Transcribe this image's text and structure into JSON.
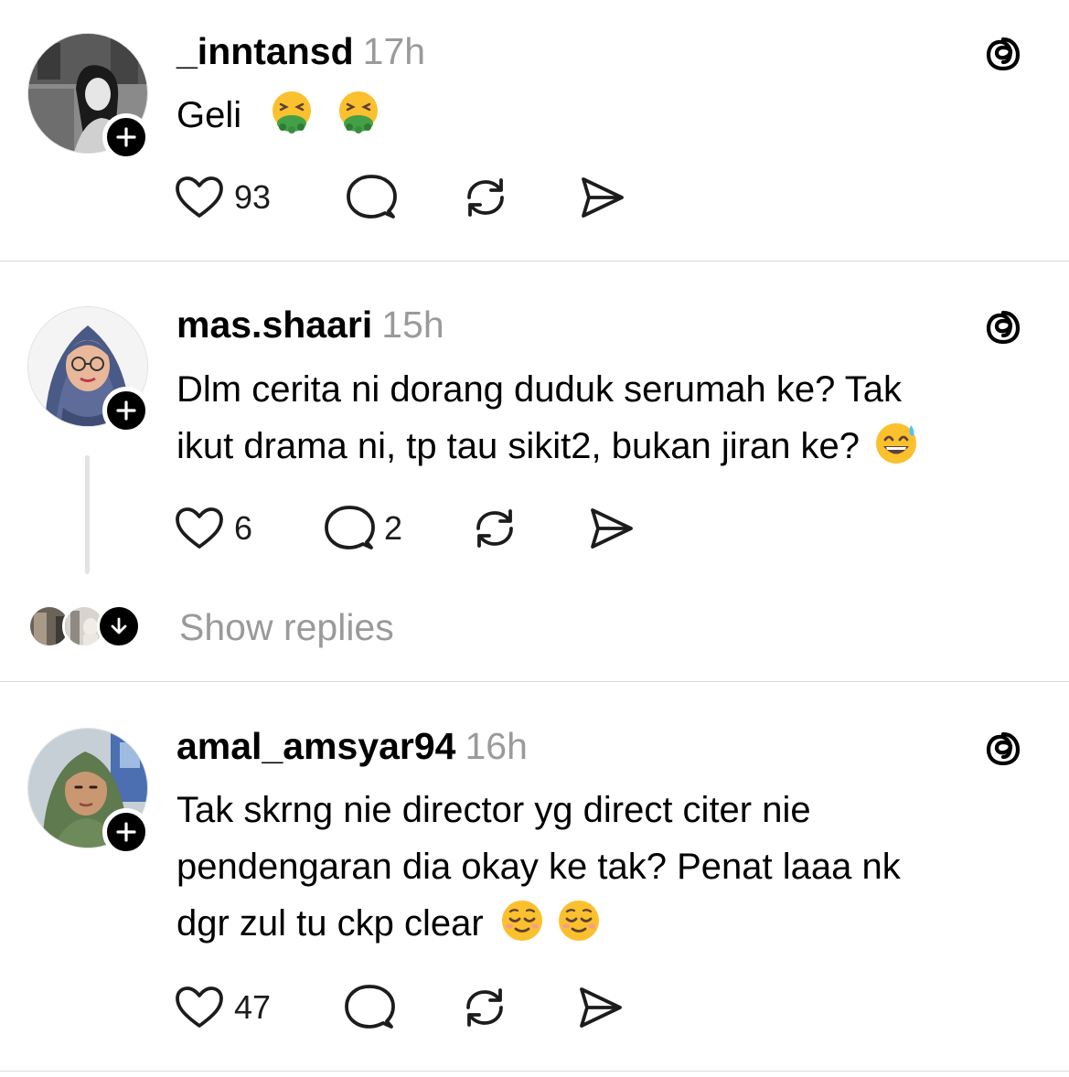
{
  "posts": [
    {
      "username": "_inntansd",
      "time": "17h",
      "text": "Geli",
      "emojis": [
        "nauseated-face-emoji",
        "nauseated-face-emoji"
      ],
      "likes": "93",
      "replies": "",
      "avatar": "grayscale-photo-avatar"
    },
    {
      "username": "mas.shaari",
      "time": "15h",
      "text_line1": "Dlm cerita ni dorang duduk serumah ke? Tak",
      "text_line2": "ikut drama ni, tp tau sikit2, bukan jiran ke?",
      "emojis": [
        "grinning-sweat-emoji"
      ],
      "likes": "6",
      "replies": "2",
      "show_replies": "Show replies",
      "avatar": "hijab-glasses-avatar"
    },
    {
      "username": "amal_amsyar94",
      "time": "16h",
      "text_line1": "Tak skrng nie director yg direct citer nie",
      "text_line2": "pendengaran dia okay ke tak? Penat laaa nk",
      "text_line3": "dgr zul tu ckp clear",
      "emojis": [
        "relieved-face-emoji",
        "relieved-face-emoji"
      ],
      "likes": "47",
      "replies": "",
      "avatar": "green-hijab-avatar"
    }
  ],
  "icons": {
    "like": "heart-icon",
    "reply": "comment-bubble-icon",
    "repost": "repost-icon",
    "share": "send-icon",
    "platform": "threads-logo-icon",
    "follow": "plus-icon"
  },
  "colors": {
    "text": "#000000",
    "muted": "#9a9a9a",
    "divider": "#d9d9d9",
    "badge": "#000000"
  }
}
